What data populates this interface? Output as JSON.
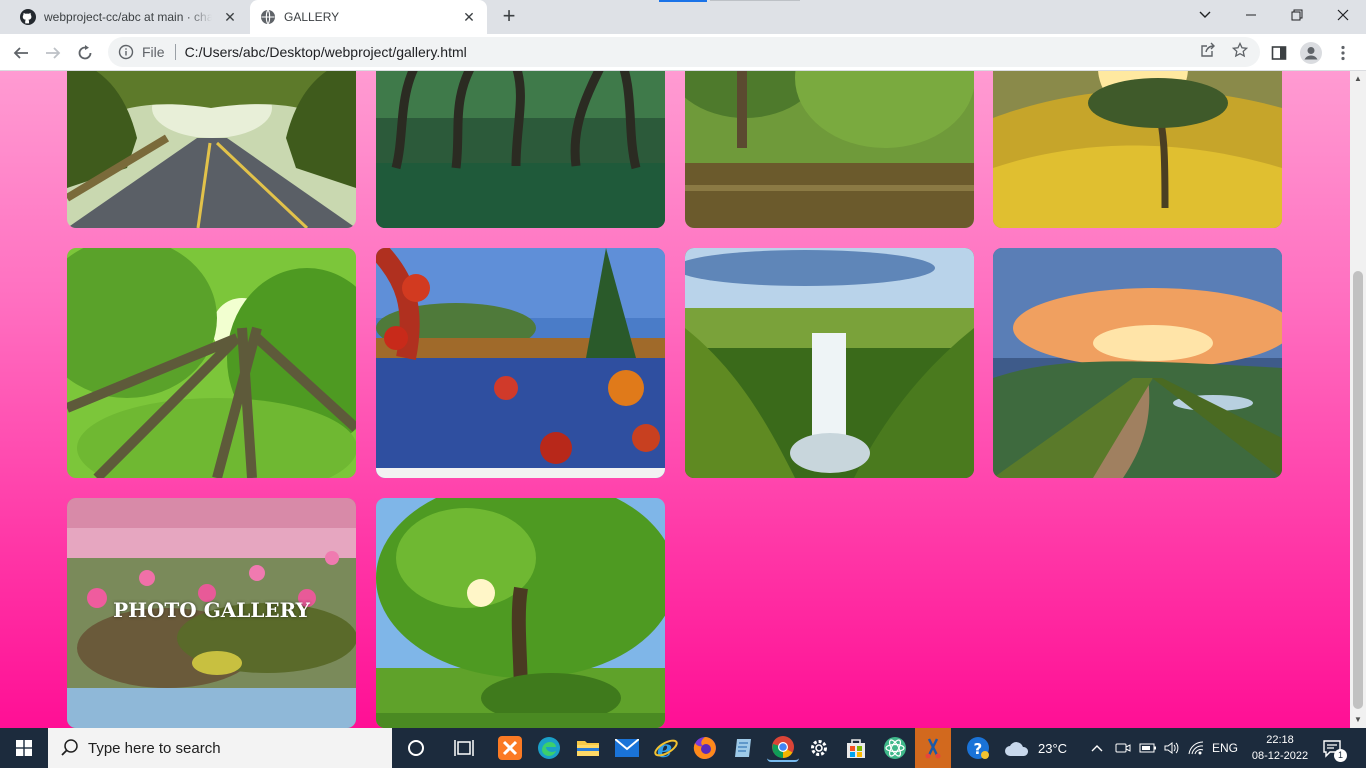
{
  "browser": {
    "tabs": [
      {
        "title": "webproject-cc/abc at main · chai",
        "icon": "github-icon",
        "active": false
      },
      {
        "title": "GALLERY",
        "icon": "globe-icon",
        "active": true
      }
    ],
    "address": {
      "scheme_label": "File",
      "url": "C:/Users/abc/Desktop/webproject/gallery.html"
    }
  },
  "gallery": {
    "caption": "PHOTO GALLERY",
    "photos": [
      {
        "subject": "tree tunnel road"
      },
      {
        "subject": "tree avenue on grass"
      },
      {
        "subject": "trees by a pond"
      },
      {
        "subject": "tree on a sunny hill"
      },
      {
        "subject": "forest canopy from below"
      },
      {
        "subject": "autumn lake with red leaves"
      },
      {
        "subject": "waterfall in green valley"
      },
      {
        "subject": "mountain path at sunset"
      },
      {
        "subject": "pink water lilies"
      },
      {
        "subject": "big green tree in meadow"
      }
    ]
  },
  "taskbar": {
    "search_placeholder": "Type here to search",
    "weather": "23°C",
    "language": "ENG",
    "time": "22:18",
    "date": "08-12-2022",
    "notification_count": "1"
  },
  "colors": {
    "page_gradient_top": "#ff9bd2",
    "page_gradient_bottom": "#ff0f95",
    "taskbar": "#1c2b3d",
    "accent": "#1a73e8"
  }
}
